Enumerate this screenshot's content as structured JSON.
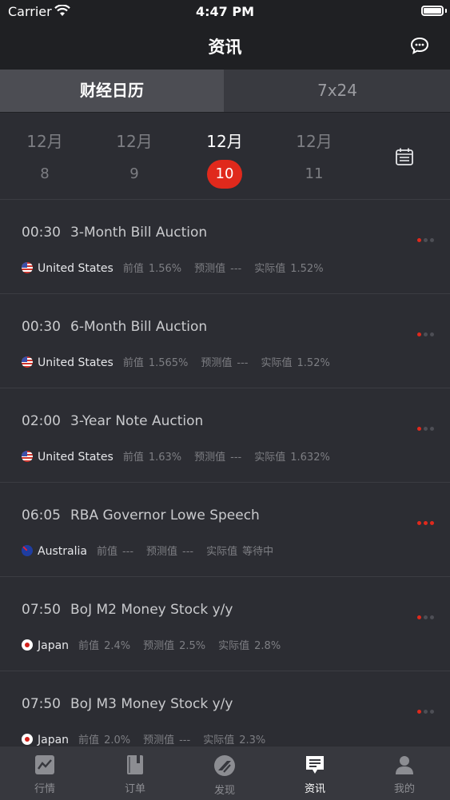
{
  "status_bar": {
    "carrier": "Carrier",
    "time": "4:47 PM"
  },
  "nav": {
    "title": "资讯",
    "right_icon": "chat-bubble-icon"
  },
  "segments": [
    {
      "label": "财经日历",
      "active": true
    },
    {
      "label": "7x24",
      "active": false
    }
  ],
  "dates": [
    {
      "month": "12月",
      "day": "8",
      "selected": false
    },
    {
      "month": "12月",
      "day": "9",
      "selected": false
    },
    {
      "month": "12月",
      "day": "10",
      "selected": true
    },
    {
      "month": "12月",
      "day": "11",
      "selected": false
    }
  ],
  "calendar_icon": "calendar-icon",
  "labels": {
    "previous": "前值",
    "forecast": "预测值",
    "actual": "实际值"
  },
  "events": [
    {
      "time": "00:30",
      "title": "3-Month Bill Auction",
      "country": "United States",
      "flag": "us",
      "previous": "1.56%",
      "forecast": "---",
      "actual": "1.52%",
      "importance": 1
    },
    {
      "time": "00:30",
      "title": "6-Month Bill Auction",
      "country": "United States",
      "flag": "us",
      "previous": "1.565%",
      "forecast": "---",
      "actual": "1.52%",
      "importance": 1
    },
    {
      "time": "02:00",
      "title": "3-Year Note Auction",
      "country": "United States",
      "flag": "us",
      "previous": "1.63%",
      "forecast": "---",
      "actual": "1.632%",
      "importance": 1
    },
    {
      "time": "06:05",
      "title": "RBA Governor Lowe Speech",
      "country": "Australia",
      "flag": "au",
      "previous": "---",
      "forecast": "---",
      "actual": "等待中",
      "importance": 3
    },
    {
      "time": "07:50",
      "title": "BoJ M2 Money Stock y/y",
      "country": "Japan",
      "flag": "jp",
      "previous": "2.4%",
      "forecast": "2.5%",
      "actual": "2.8%",
      "importance": 1
    },
    {
      "time": "07:50",
      "title": "BoJ M3 Money Stock y/y",
      "country": "Japan",
      "flag": "jp",
      "previous": "2.0%",
      "forecast": "---",
      "actual": "2.3%",
      "importance": 1
    }
  ],
  "tabbar": [
    {
      "label": "行情",
      "icon": "chart-icon",
      "active": false
    },
    {
      "label": "订单",
      "icon": "book-icon",
      "active": false
    },
    {
      "label": "发现",
      "icon": "compass-icon",
      "active": false
    },
    {
      "label": "资讯",
      "icon": "news-icon",
      "active": true
    },
    {
      "label": "我的",
      "icon": "person-icon",
      "active": false
    }
  ],
  "colors": {
    "accent": "#e0291c",
    "background": "#2c2d33",
    "header": "#1f2023"
  }
}
